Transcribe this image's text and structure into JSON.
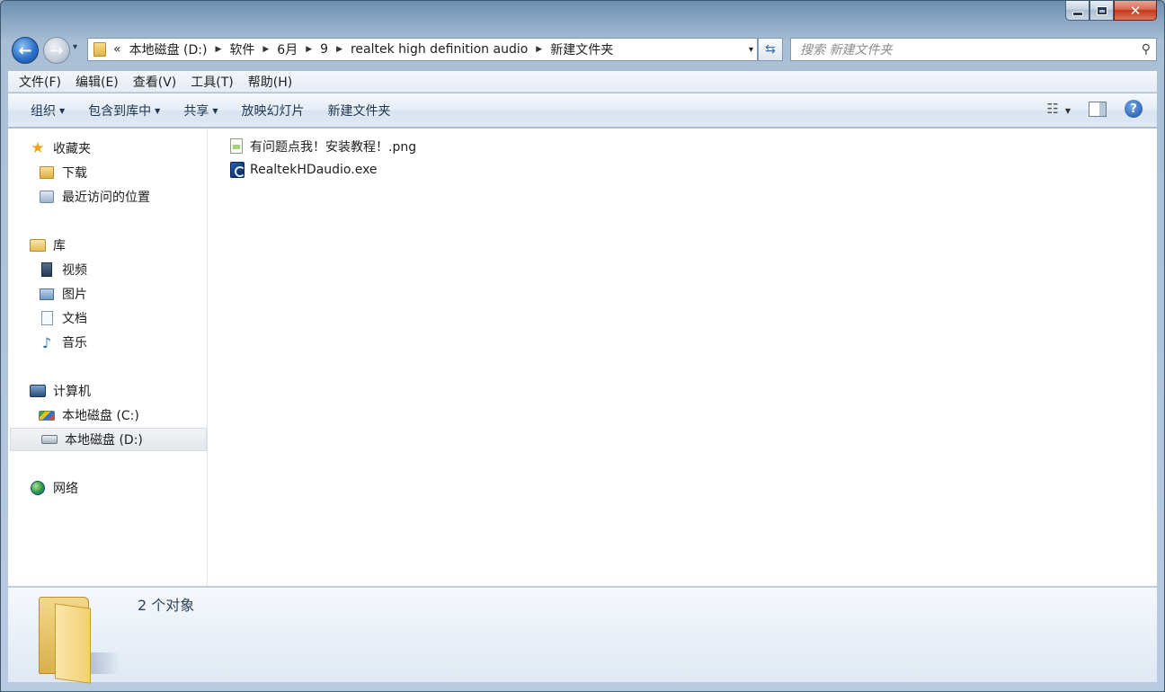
{
  "window": {
    "caption": {
      "minimize_icon": "minimize-icon",
      "maximize_icon": "maximize-icon",
      "close_glyph": "✕"
    }
  },
  "nav": {
    "back_glyph": "←",
    "forward_glyph": "→",
    "recent_glyph": "▾",
    "address": {
      "overflow": "«",
      "crumbs": [
        "本地磁盘 (D:)",
        "软件",
        "6月",
        "9",
        "realtek high definition audio",
        "新建文件夹"
      ],
      "separator": "▶",
      "dropdown_glyph": "▾"
    },
    "refresh_glyph": "⇆",
    "search": {
      "placeholder": "搜索 新建文件夹",
      "icon_glyph": "⚲"
    }
  },
  "menu": {
    "items": [
      "文件(F)",
      "编辑(E)",
      "查看(V)",
      "工具(T)",
      "帮助(H)"
    ]
  },
  "commands": {
    "items": [
      {
        "label": "组织",
        "has_arrow": true
      },
      {
        "label": "包含到库中",
        "has_arrow": true
      },
      {
        "label": "共享",
        "has_arrow": true
      },
      {
        "label": "放映幻灯片",
        "has_arrow": false
      },
      {
        "label": "新建文件夹",
        "has_arrow": false
      }
    ],
    "arrow_glyph": "▼",
    "views_glyph": "☷",
    "help_glyph": "?"
  },
  "navigation_pane": {
    "favorites": {
      "label": "收藏夹",
      "items": [
        "下载",
        "最近访问的位置"
      ]
    },
    "libraries": {
      "label": "库",
      "items": [
        "视频",
        "图片",
        "文档",
        "音乐"
      ]
    },
    "computer": {
      "label": "计算机",
      "items": [
        "本地磁盘 (C:)",
        "本地磁盘 (D:)"
      ],
      "selected": "本地磁盘 (D:)"
    },
    "network": {
      "label": "网络"
    }
  },
  "files": [
    {
      "name": "有问题点我！安装教程！.png",
      "icon": "png-file-icon"
    },
    {
      "name": "RealtekHDaudio.exe",
      "icon": "exe-file-icon"
    }
  ],
  "details": {
    "count_text": "2 个对象"
  },
  "colors": {
    "title_gradient": "#6d8fb0",
    "close_red": "#c5371c",
    "selection": "#e3e7ec"
  }
}
